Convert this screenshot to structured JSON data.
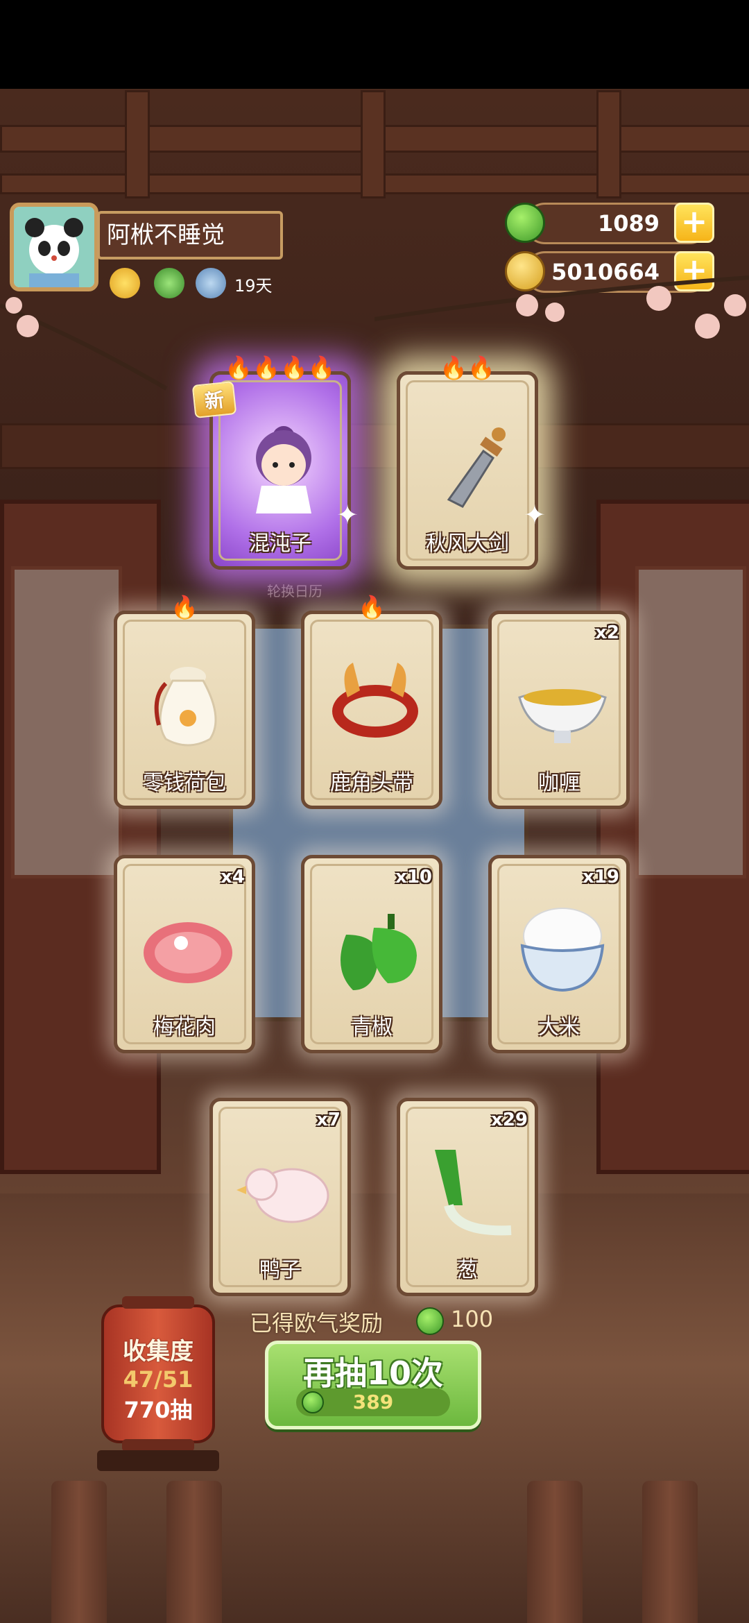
{
  "player": {
    "name": "阿栿不睡觉",
    "days": "19天"
  },
  "currency": {
    "jade": "1089",
    "coins": "5010664"
  },
  "cards": [
    {
      "id": "c1",
      "name": "混沌子",
      "count": "",
      "new": "新",
      "flames": "🔥🔥🔥🔥",
      "rarity": "purple"
    },
    {
      "id": "c2",
      "name": "秋风大剑",
      "count": "",
      "flames": "🔥🔥",
      "rarity": "gold"
    },
    {
      "id": "c3",
      "name": "零钱荷包",
      "count": "",
      "flames": "🔥"
    },
    {
      "id": "c4",
      "name": "鹿角头带",
      "count": "",
      "flames": "🔥"
    },
    {
      "id": "c5",
      "name": "咖喱",
      "count": "x2"
    },
    {
      "id": "c6",
      "name": "梅花肉",
      "count": "x4"
    },
    {
      "id": "c7",
      "name": "青椒",
      "count": "x10"
    },
    {
      "id": "c8",
      "name": "大米",
      "count": "x19"
    },
    {
      "id": "c9",
      "name": "鸭子",
      "count": "x7"
    },
    {
      "id": "c10",
      "name": "葱",
      "count": "x29"
    }
  ],
  "background_text": "轮换日历",
  "reward": {
    "label": "已得欧气奖励",
    "value": "100"
  },
  "draw_button": {
    "label": "再抽10次",
    "cost": "389"
  },
  "collection": {
    "title": "收集度",
    "progress": "47/51",
    "draws": "770抽"
  },
  "colors": {
    "accent_green": "#6cb83e",
    "gold": "#f6b419",
    "purple_glow": "#b070e8"
  }
}
